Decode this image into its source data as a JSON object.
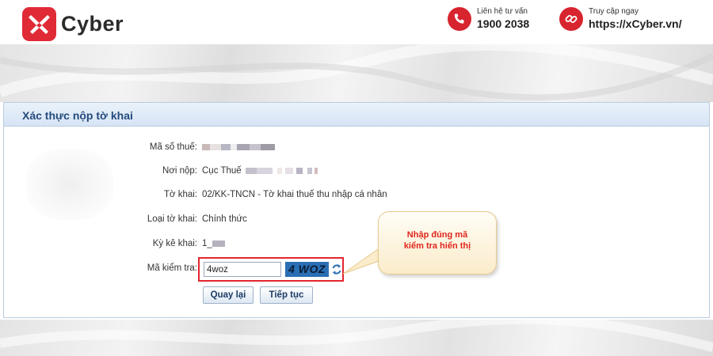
{
  "brand": {
    "name": "Cyber"
  },
  "contacts": [
    {
      "label": "Liên hệ tư vấn",
      "value": "1900 2038",
      "icon": "phone-icon"
    },
    {
      "label": "Truy cập ngay",
      "value": "https://xCyber.vn/",
      "icon": "link-icon"
    }
  ],
  "form": {
    "title": "Xác thực nộp tờ khai",
    "fields": {
      "tax_code_label": "Mã số thuế:",
      "submit_to_label": "Nơi nộp:",
      "submit_to_value": "Cục Thuế",
      "declaration_label": "Tờ khai:",
      "declaration_value": "02/KK-TNCN - Tờ khai thuế thu nhập cá nhân",
      "type_label": "Loại tờ khai:",
      "type_value": "Chính thức",
      "period_label": "Kỳ kê khai:",
      "period_value": "1_",
      "captcha_label": "Mã kiểm tra:",
      "captcha_value": "4woz",
      "captcha_image_text": "4 WOZ"
    },
    "buttons": {
      "back": "Quay lại",
      "next": "Tiếp tục"
    }
  },
  "callout": {
    "line1": "Nhập đúng mã",
    "line2": "kiểm tra hiển thị"
  },
  "colors": {
    "brand_red": "#e02a36",
    "panel_title": "#234a7c",
    "highlight_border": "#e2262e",
    "callout_text": "#e0261c"
  }
}
